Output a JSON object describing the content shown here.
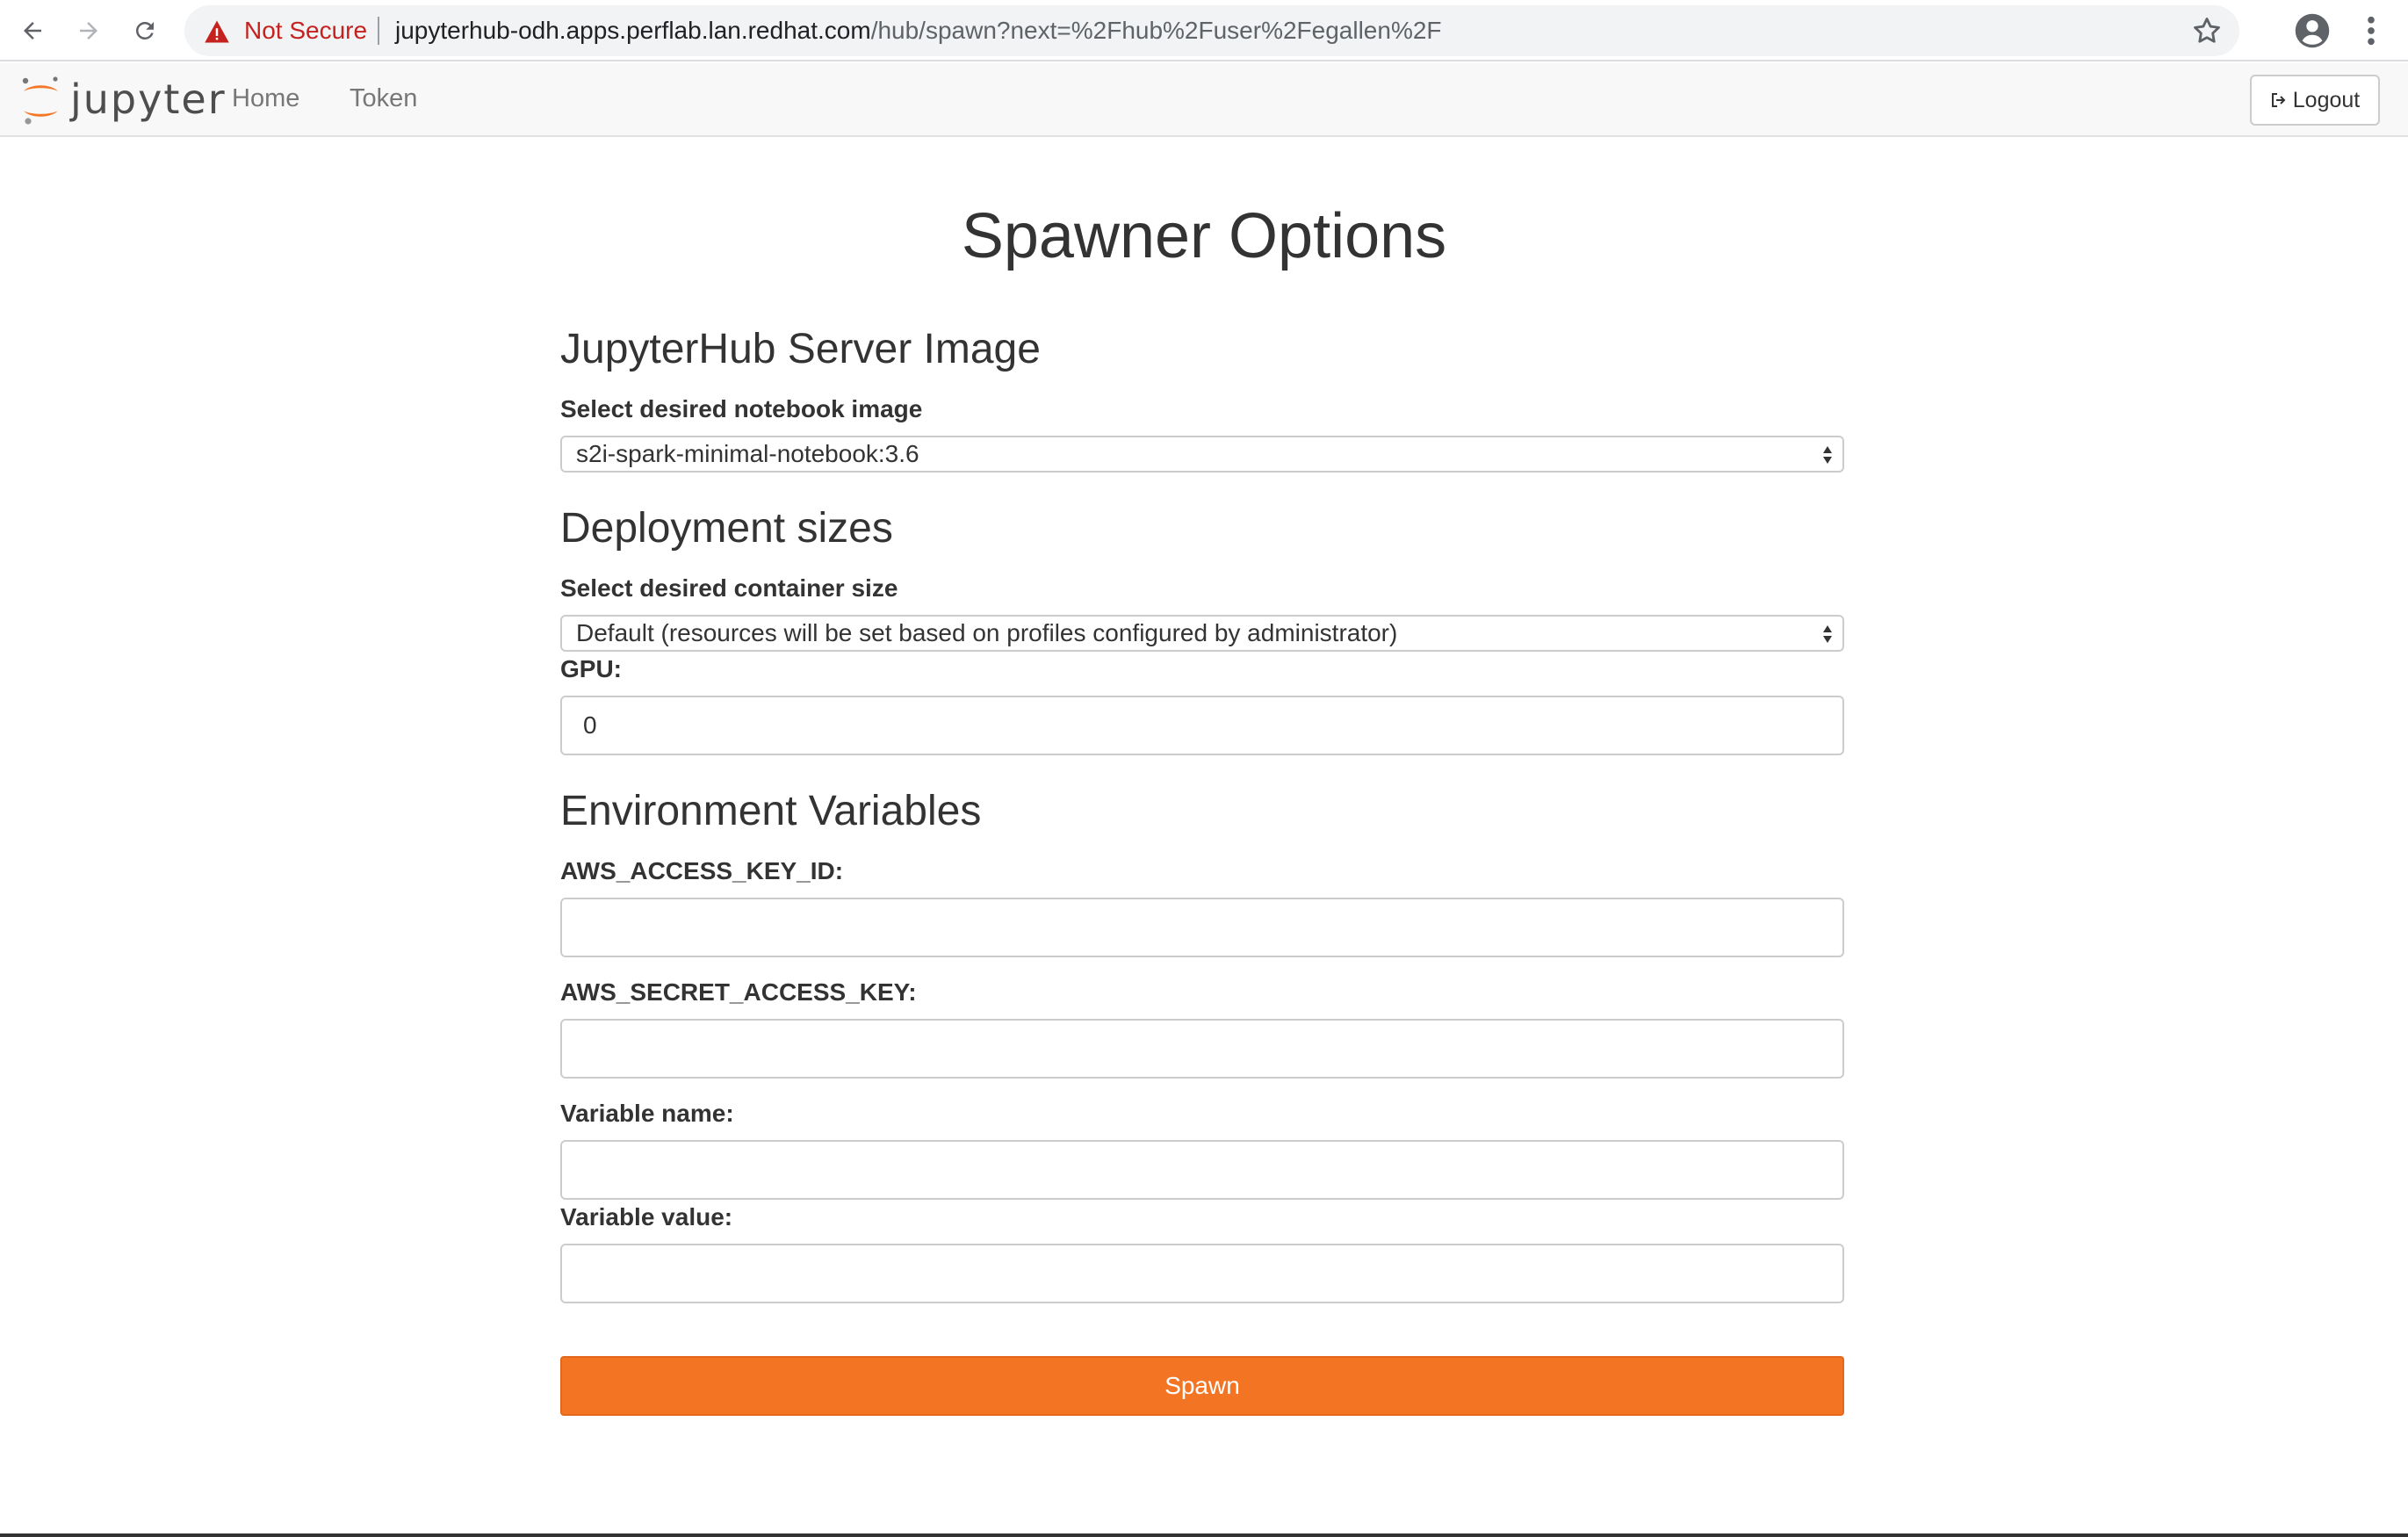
{
  "browser": {
    "security_label": "Not Secure",
    "url_host": "jupyterhub-odh.apps.perflab.lan.redhat.com",
    "url_path": "/hub/spawn?next=%2Fhub%2Fuser%2Fegallen%2F"
  },
  "header": {
    "logo_text": "jupyter",
    "nav": [
      {
        "label": "Home"
      },
      {
        "label": "Token"
      }
    ],
    "logout_label": "Logout"
  },
  "page": {
    "title": "Spawner Options"
  },
  "image_section": {
    "title": "JupyterHub Server Image",
    "select_label": "Select desired notebook image",
    "selected_image": "s2i-spark-minimal-notebook:3.6"
  },
  "size_section": {
    "title": "Deployment sizes",
    "select_label": "Select desired container size",
    "selected_size": "Default (resources will be set based on profiles configured by administrator)",
    "gpu_label": "GPU:",
    "gpu_value": "0"
  },
  "env_section": {
    "title": "Environment Variables",
    "fields": [
      {
        "label": "AWS_ACCESS_KEY_ID:",
        "value": ""
      },
      {
        "label": "AWS_SECRET_ACCESS_KEY:",
        "value": ""
      },
      {
        "label": "Variable name:",
        "value": ""
      },
      {
        "label": "Variable value:",
        "value": ""
      }
    ]
  },
  "spawn_label": "Spawn",
  "colors": {
    "accent": "#f37524",
    "insecure": "#c5221f"
  }
}
